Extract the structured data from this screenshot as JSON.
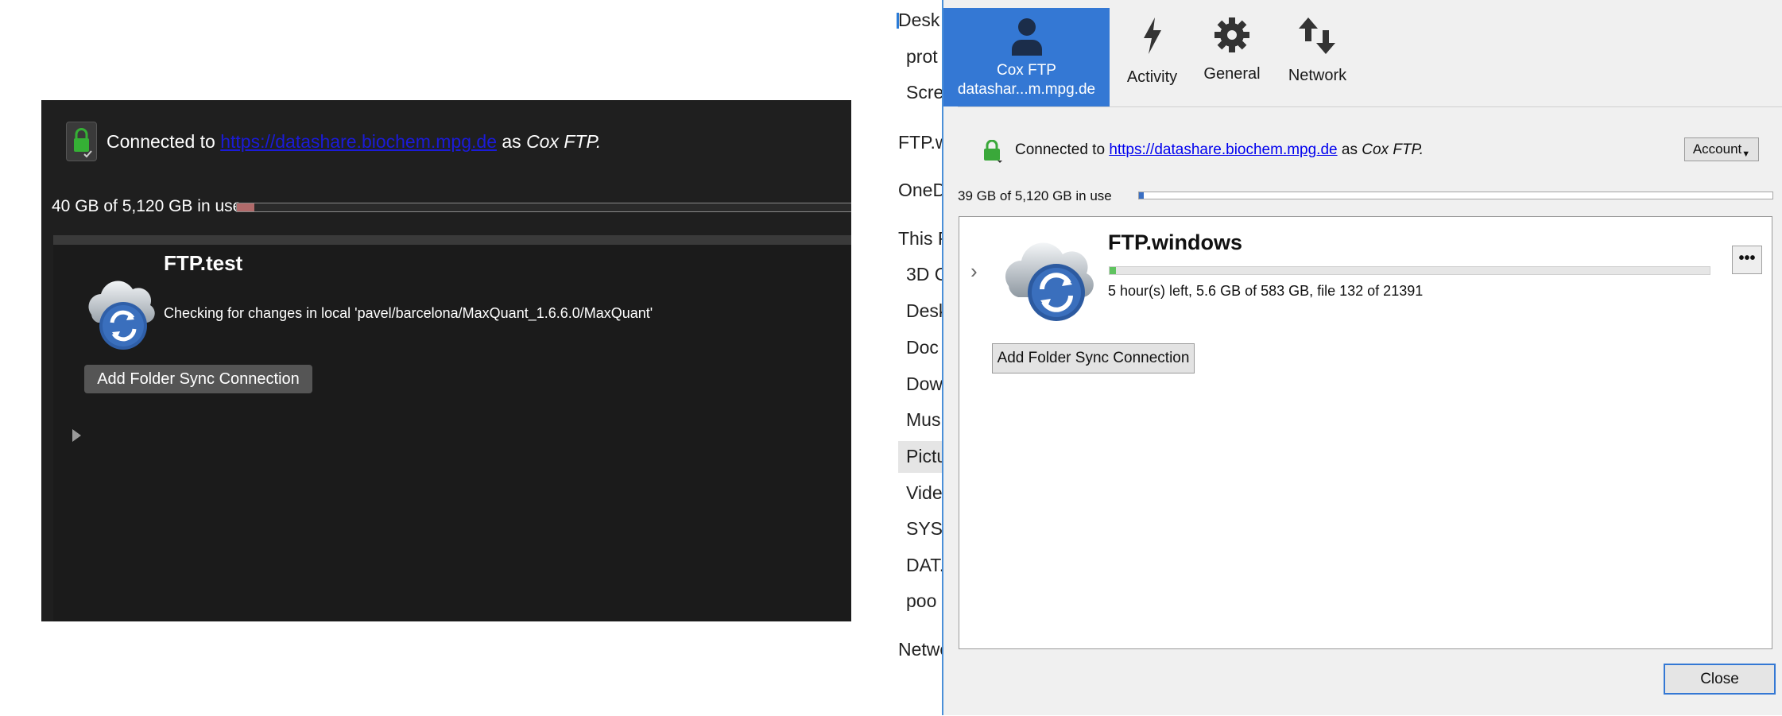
{
  "mac_panel": {
    "connected_prefix": "Connected to",
    "url": "https://datashare.biochem.mpg.de",
    "as_text": "as",
    "account_name": "Cox FTP.",
    "usage_text": "40 GB of 5,120 GB in use",
    "usage_fraction": 0.008,
    "item": {
      "title": "FTP.test",
      "status": "Checking for changes in local 'pavel/barcelona/MaxQuant_1.6.6.0/MaxQuant'"
    },
    "add_button": "Add Folder Sync Connection"
  },
  "explorer": {
    "items": [
      {
        "label": "Desk"
      },
      {
        "label": "prot"
      },
      {
        "label": "Scre"
      },
      {
        "label": "FTP.w"
      },
      {
        "label": "OneD"
      },
      {
        "label": "This P"
      },
      {
        "label": "3D C"
      },
      {
        "label": "Desk"
      },
      {
        "label": "Doc"
      },
      {
        "label": "Dow"
      },
      {
        "label": "Mus"
      },
      {
        "label": "Pictu"
      },
      {
        "label": "Vide"
      },
      {
        "label": "SYST"
      },
      {
        "label": "DAT."
      },
      {
        "label": "poo"
      },
      {
        "label": "Netwo"
      }
    ]
  },
  "win_panel": {
    "tabs": [
      {
        "name": "Cox FTP",
        "sub": "datashar...m.mpg.de",
        "icon": "user-icon"
      },
      {
        "name": "Activity",
        "icon": "lightning-icon"
      },
      {
        "name": "General",
        "icon": "gear-icon"
      },
      {
        "name": "Network",
        "icon": "up-down-arrows-icon"
      }
    ],
    "connected_prefix": "Connected to",
    "url": "https://datashare.biochem.mpg.de",
    "as_text": "as",
    "account_name": "Cox FTP.",
    "account_button": "Account",
    "usage_text": "39 GB of 5,120 GB in use",
    "usage_fraction": 0.008,
    "item": {
      "title": "FTP.windows",
      "progress_fraction": 0.01,
      "status": "5 hour(s) left, 5.6 GB of 583 GB, file 132 of 21391",
      "more_label": "•••"
    },
    "add_button": "Add Folder Sync Connection",
    "close_button": "Close"
  }
}
